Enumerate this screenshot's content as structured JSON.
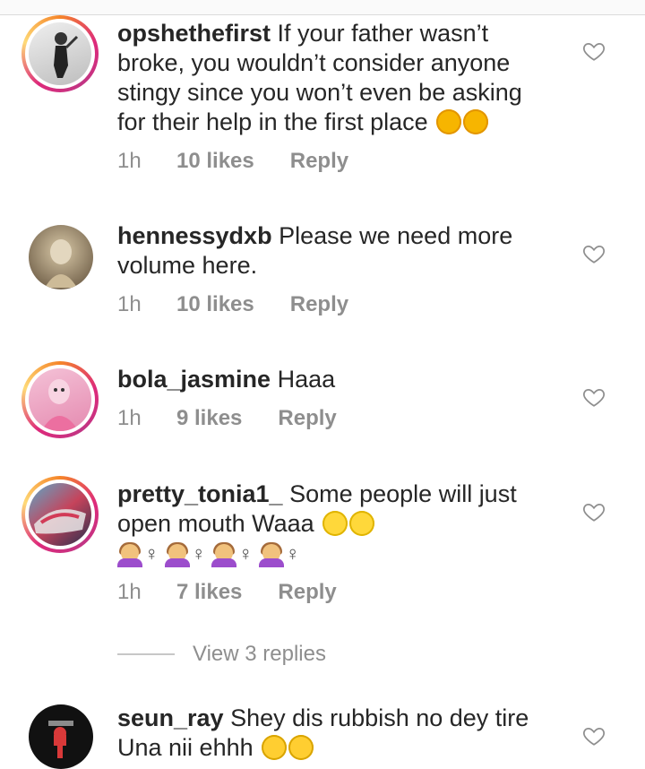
{
  "comments": [
    {
      "username": "opshethefirst",
      "text": "If your father wasn’t broke, you wouldn’t consider anyone stingy since you won’t even be asking for their help in the first place",
      "emojis": [
        "rolling-laughing-emoji",
        "rolling-laughing-emoji"
      ],
      "time": "1h",
      "likes": "10 likes",
      "reply": "Reply"
    },
    {
      "username": "hennessydxb",
      "text": "Please we need more volume here.",
      "time": "1h",
      "likes": "10 likes",
      "reply": "Reply"
    },
    {
      "username": "bola_jasmine",
      "text": "Haaa",
      "time": "1h",
      "likes": "9 likes",
      "reply": "Reply"
    },
    {
      "username": "pretty_tonia1_",
      "text": "Some people will just open mouth Waaa",
      "emojis": [
        "eye-roll-emoji",
        "eye-roll-emoji"
      ],
      "extra_symbol": "♀",
      "time": "1h",
      "likes": "7 likes",
      "reply": "Reply"
    },
    {
      "username": "seun_ray",
      "text": "Shey dis rubbish no dey tire Una nii ehhh",
      "emojis": [
        "unamused-emoji",
        "unamused-emoji"
      ]
    }
  ],
  "view_replies": "View 3 replies",
  "colors": {
    "username": "#262626",
    "meta": "#8e8e8e",
    "story_ring": "#dd2a7b"
  }
}
